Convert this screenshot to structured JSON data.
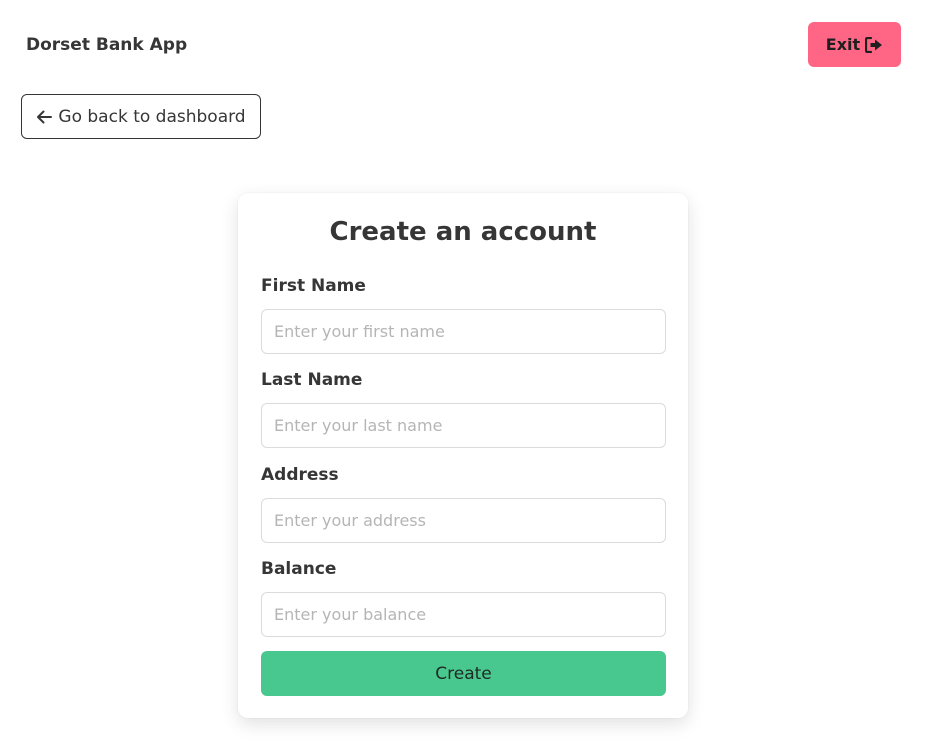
{
  "navbar": {
    "brand": "Dorset Bank App",
    "exit_label": "Exit",
    "exit_icon": "sign-out-icon"
  },
  "back_button": {
    "label": "Go back to dashboard",
    "icon": "arrow-left-icon"
  },
  "form": {
    "title": "Create an account",
    "fields": [
      {
        "label": "First Name",
        "placeholder": "Enter your first name",
        "value": ""
      },
      {
        "label": "Last Name",
        "placeholder": "Enter your last name",
        "value": ""
      },
      {
        "label": "Address",
        "placeholder": "Enter your address",
        "value": ""
      },
      {
        "label": "Balance",
        "placeholder": "Enter your balance",
        "value": ""
      }
    ],
    "submit_label": "Create"
  },
  "colors": {
    "exit_button": "#ff6685",
    "create_button": "#48c78e",
    "text": "#363636",
    "input_border": "#dbdbdb",
    "placeholder": "#b5b5b5"
  }
}
